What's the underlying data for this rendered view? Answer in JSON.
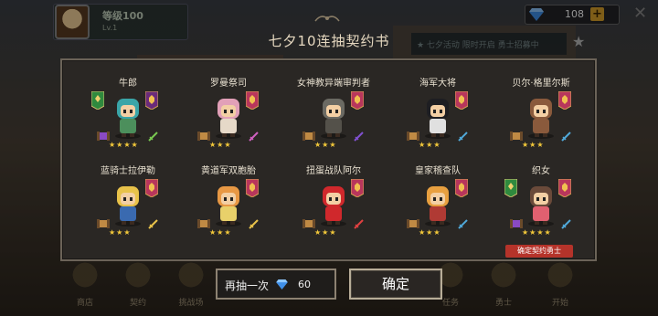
{
  "player": {
    "name": "等级100",
    "sub": "Lv.1"
  },
  "gems": {
    "count": "108",
    "plus": "+"
  },
  "news": "★ 七夕活动 限时开启 勇士招募中",
  "bottom_nav": [
    "商店",
    "契约",
    "挑战场",
    "",
    "任务",
    "",
    "勇士",
    "开始"
  ],
  "dialog": {
    "title": "七夕10连抽契约书",
    "cards": [
      {
        "name": "牛郎",
        "stars": "★★★★",
        "hair": "#3aa5a8",
        "body": "#4c8f5c",
        "emblem": "#6a2a7a",
        "left_emblem": "#2f8a3e",
        "class_color": "#8a4ac4",
        "weapon_color": "#78c850"
      },
      {
        "name": "罗曼祭司",
        "stars": "★★★",
        "hair": "#e2a0b8",
        "body": "#e6d9c8",
        "emblem": "#b8365c",
        "left_emblem": "",
        "class_color": "#c08a44",
        "weapon_color": "#d060c0"
      },
      {
        "name": "女神教异端审判者",
        "stars": "★★★",
        "hair": "#6b6a63",
        "body": "#54514a",
        "emblem": "#b8365c",
        "left_emblem": "",
        "class_color": "#c08a44",
        "weapon_color": "#8050d0"
      },
      {
        "name": "海军大将",
        "stars": "★★★",
        "hair": "#1e1e22",
        "body": "#e0e0e0",
        "emblem": "#b8365c",
        "left_emblem": "",
        "class_color": "#c08a44",
        "weapon_color": "#50a8d8"
      },
      {
        "name": "贝尔·格里尔斯",
        "stars": "★★★",
        "hair": "#8a5a3c",
        "body": "#8a5a3c",
        "emblem": "#b8365c",
        "left_emblem": "",
        "class_color": "#c08a44",
        "weapon_color": "#50a8d8"
      },
      {
        "name": "蓝骑士拉伊勒",
        "stars": "★★★",
        "hair": "#e8c24a",
        "body": "#3a6ab0",
        "emblem": "#b8365c",
        "left_emblem": "",
        "class_color": "#c08a44",
        "weapon_color": "#e8c24a"
      },
      {
        "name": "黄道军双胞胎",
        "stars": "★★★",
        "hair": "#e89844",
        "body": "#e8d06a",
        "emblem": "#b8365c",
        "left_emblem": "",
        "class_color": "#c08a44",
        "weapon_color": "#e8c24a"
      },
      {
        "name": "扭蛋战队阿尔",
        "stars": "★★★",
        "hair": "#d0282c",
        "body": "#d0282c",
        "emblem": "#b8365c",
        "left_emblem": "",
        "class_color": "#c08a44",
        "weapon_color": "#e04040"
      },
      {
        "name": "皇家稽查队",
        "stars": "★★★",
        "hair": "#e8a040",
        "body": "#b03a34",
        "emblem": "#b8365c",
        "left_emblem": "",
        "class_color": "#c08a44",
        "weapon_color": "#50a8d8"
      },
      {
        "name": "织女",
        "stars": "★★★★",
        "hair": "#6a4a3a",
        "body": "#e06070",
        "emblem": "#b8365c",
        "left_emblem": "#2f8a3e",
        "class_color": "#8a4ac4",
        "weapon_color": "#50a8d8"
      }
    ],
    "confirm_tag": "确定契约勇士",
    "again_label": "再抽一次",
    "again_cost": "60",
    "ok_label": "确定"
  }
}
